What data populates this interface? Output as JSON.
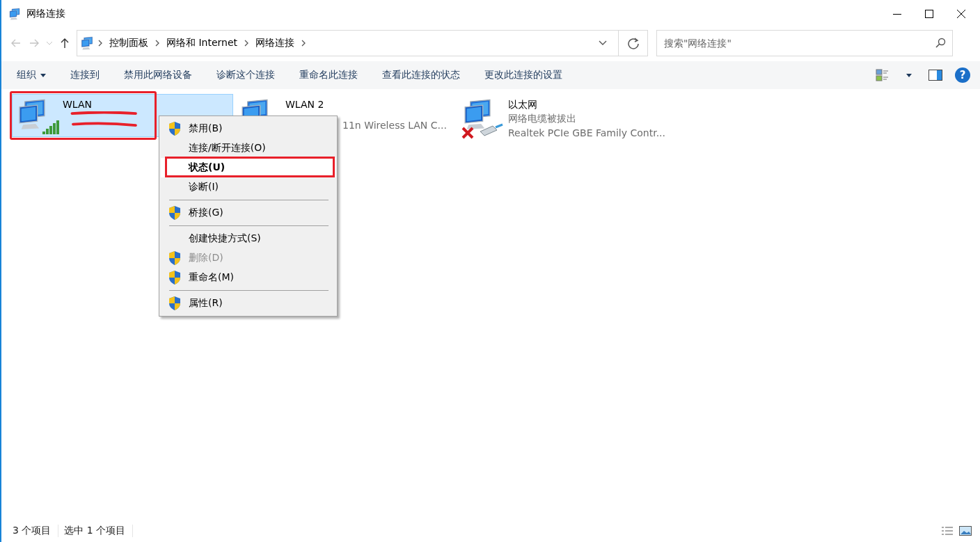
{
  "window": {
    "title": "网络连接"
  },
  "address_bar": {
    "breadcrumbs": [
      "控制面板",
      "网络和 Internet",
      "网络连接"
    ]
  },
  "search": {
    "placeholder": "搜索\"网络连接\""
  },
  "toolbar": {
    "buttons": [
      {
        "label": "组织",
        "dropdown": true
      },
      {
        "label": "连接到",
        "dropdown": false
      },
      {
        "label": "禁用此网络设备",
        "dropdown": false
      },
      {
        "label": "诊断这个连接",
        "dropdown": false
      },
      {
        "label": "重命名此连接",
        "dropdown": false
      },
      {
        "label": "查看此连接的状态",
        "dropdown": false
      },
      {
        "label": "更改此连接的设置",
        "dropdown": false
      }
    ],
    "help_button": {
      "label": "?"
    }
  },
  "connections": [
    {
      "name": "WLAN",
      "kind": "wifi",
      "selected": true,
      "annotated": true,
      "redacted": true
    },
    {
      "name": "WLAN 2",
      "kind": "wifi-off",
      "selected": false,
      "annotated": false,
      "redacted": false,
      "device": "11n Wireless LAN C..."
    },
    {
      "name": "以太网",
      "kind": "ethernet",
      "selected": false,
      "annotated": false,
      "redacted": false,
      "status": "网络电缆被拔出",
      "device": "Realtek PCIe GBE Family Contr..."
    }
  ],
  "context_menu": {
    "items": [
      {
        "kind": "item",
        "label": "禁用(B)",
        "shield": true,
        "disabled": false,
        "selected": false,
        "annotated": false
      },
      {
        "kind": "item",
        "label": "连接/断开连接(O)",
        "shield": false,
        "disabled": false,
        "selected": false,
        "annotated": false
      },
      {
        "kind": "item",
        "label": "状态(U)",
        "shield": false,
        "disabled": false,
        "selected": true,
        "annotated": true
      },
      {
        "kind": "item",
        "label": "诊断(I)",
        "shield": false,
        "disabled": false,
        "selected": false,
        "annotated": false
      },
      {
        "kind": "separator"
      },
      {
        "kind": "item",
        "label": "桥接(G)",
        "shield": true,
        "disabled": false,
        "selected": false,
        "annotated": false
      },
      {
        "kind": "separator"
      },
      {
        "kind": "item",
        "label": "创建快捷方式(S)",
        "shield": false,
        "disabled": false,
        "selected": false,
        "annotated": false
      },
      {
        "kind": "item",
        "label": "删除(D)",
        "shield": true,
        "disabled": true,
        "selected": false,
        "annotated": false
      },
      {
        "kind": "item",
        "label": "重命名(M)",
        "shield": true,
        "disabled": false,
        "selected": false,
        "annotated": false
      },
      {
        "kind": "separator"
      },
      {
        "kind": "item",
        "label": "属性(R)",
        "shield": true,
        "disabled": false,
        "selected": false,
        "annotated": false
      }
    ]
  },
  "status_bar": {
    "item_count": "3 个项目",
    "selection": "选中 1 个项目"
  }
}
